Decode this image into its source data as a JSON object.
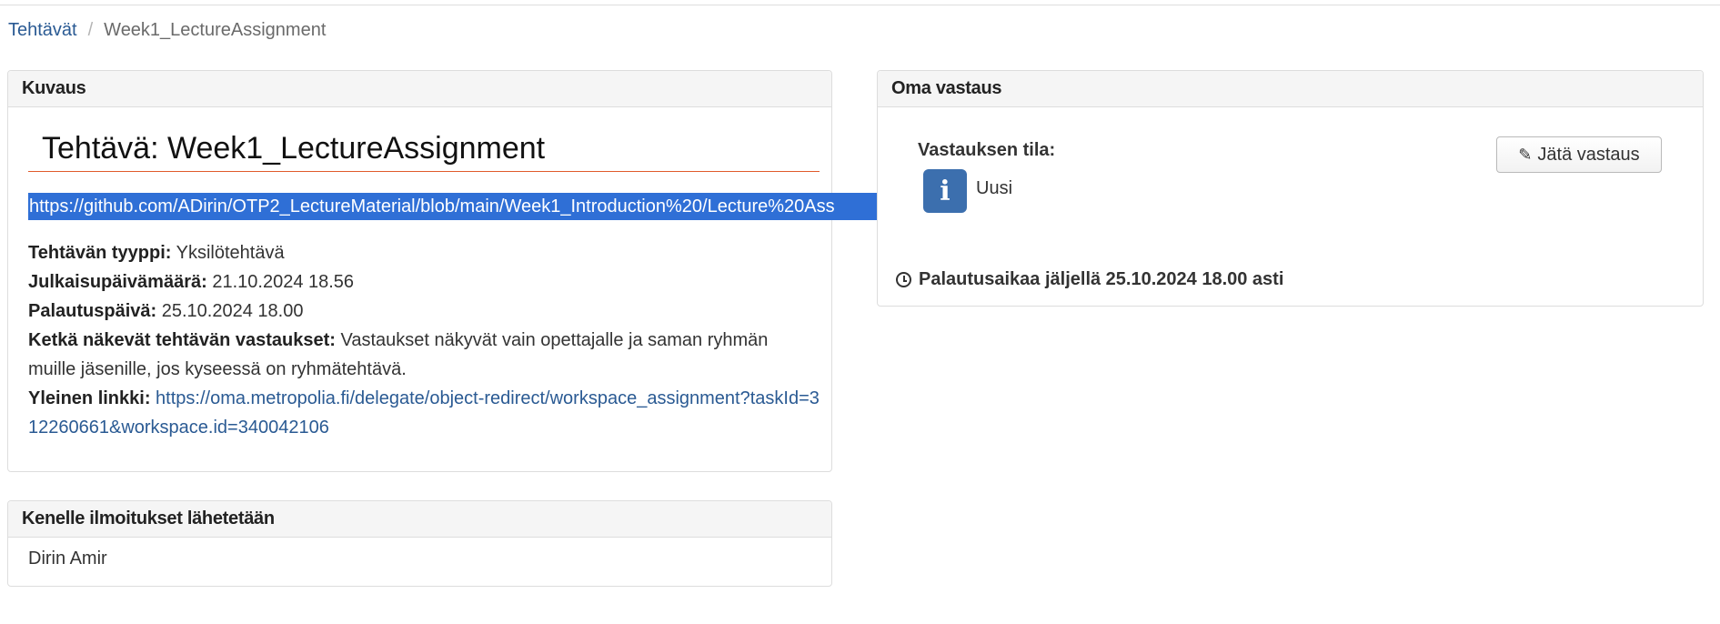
{
  "breadcrumb": {
    "root": "Tehtävät",
    "separator": "/",
    "current": "Week1_LectureAssignment"
  },
  "description_panel": {
    "heading": "Kuvaus",
    "title": "Tehtävä: Week1_LectureAssignment",
    "selected_link": "https://github.com/ADirin/OTP2_LectureMaterial/blob/main/Week1_Introduction%20/Lecture%20Ass",
    "type_label": "Tehtävän tyyppi:",
    "type_value": "Yksilötehtävä",
    "published_label": "Julkaisupäivämäärä:",
    "published_value": "21.10.2024 18.56",
    "due_label": "Palautuspäivä:",
    "due_value": "25.10.2024 18.00",
    "visibility_label": "Ketkä näkevät tehtävän vastaukset:",
    "visibility_value": "Vastaukset näkyvät vain opettajalle ja saman ryhmän muille jäsenille, jos kyseessä on ryhmätehtävä.",
    "public_link_label": "Yleinen linkki:",
    "public_link_value": "https://oma.metropolia.fi/delegate/object-redirect/workspace_assignment?taskId=312260661&workspace.id=340042106"
  },
  "answer_panel": {
    "heading": "Oma vastaus",
    "status_label": "Vastauksen tila:",
    "status_icon": "info-icon",
    "status_value": "Uusi",
    "submit_button": "Jätä vastaus",
    "deadline_text": "Palautusaikaa jäljellä 25.10.2024 18.00 asti"
  },
  "notify_panel": {
    "heading": "Kenelle ilmoitukset lähetetään",
    "recipient": "Dirin Amir"
  },
  "colors": {
    "link": "#2a5a93",
    "selection": "#2f6fd6",
    "title_rule": "#e05a2b",
    "status_icon_bg": "#3c6fae"
  }
}
